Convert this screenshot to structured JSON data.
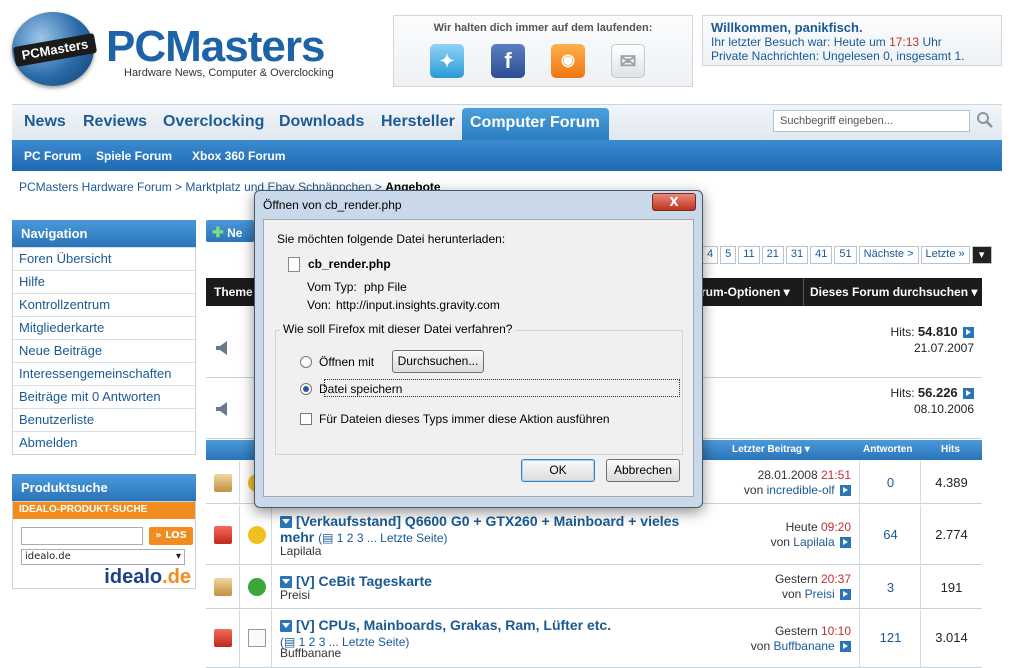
{
  "header": {
    "logo_badge": "PCMasters",
    "brand": "PCMasters",
    "tagline": "Hardware News, Computer & Overclocking",
    "social_title": "Wir halten dich immer auf dem laufenden:",
    "social_icons": [
      "twitter-icon",
      "facebook-icon",
      "rss-icon",
      "newsletter-icon"
    ],
    "welcome": {
      "greeting": "Willkommen, panikfisch.",
      "last_visit_prefix": "Ihr letzter Besuch war: Heute um ",
      "last_visit_time": "17:13",
      "last_visit_suffix": " Uhr",
      "messages": "Private Nachrichten: Ungelesen 0, insgesamt 1."
    }
  },
  "nav": {
    "items": [
      "News",
      "Reviews",
      "Overclocking",
      "Downloads",
      "Hersteller"
    ],
    "active": "Computer Forum",
    "search_placeholder": "Suchbegriff eingeben...",
    "sub_items": [
      "PC Forum",
      "Spiele Forum",
      "Xbox 360 Forum"
    ]
  },
  "breadcrumb": {
    "items": [
      "PCMasters Hardware Forum",
      "Marktplatz und Ebay Schnäppchen"
    ],
    "separator": ">",
    "current": "Angebote"
  },
  "sidebar": {
    "nav_title": "Navigation",
    "nav_items": [
      "Foren Übersicht",
      "Hilfe",
      "Kontrollzentrum",
      "Mitgliederkarte",
      "Neue Beiträge",
      "Interessengemeinschaften",
      "Beiträge mit 0 Antworten",
      "Benutzerliste",
      "Abmelden"
    ],
    "product_title": "Produktsuche",
    "idealo_bar": "IDEALO-PRODUKT-SUCHE",
    "idealo_button": "LOS",
    "idealo_select": "idealo.de",
    "idealo_logo_main": "idealo",
    "idealo_logo_tld": ".de"
  },
  "forum": {
    "new_button": "Ne",
    "pager": [
      "4",
      "5",
      "11",
      "21",
      "31",
      "41",
      "51",
      "Nächste >",
      "Letzte »"
    ],
    "toolbar": {
      "themes": "Theme",
      "forum_options": "rum-Optionen",
      "search_forum": "Dieses Forum durchsuchen"
    },
    "sticky": [
      {
        "hits_label": "Hits:",
        "hits": "54.810",
        "date": "21.07.2007"
      },
      {
        "hits_label": "Hits:",
        "hits": "56.226",
        "date": "08.10.2006"
      }
    ],
    "columns": {
      "last_post": "Letzter Beitrag",
      "answers": "Antworten",
      "hits": "Hits"
    },
    "threads": [
      {
        "title": "",
        "pages": "",
        "author": "",
        "last_date": "28.01.2008",
        "last_time": "21:51",
        "by": "von",
        "last_user": "incredible-olf",
        "answers": "0",
        "hits": "4.389"
      },
      {
        "title": "[Verkaufsstand] Q6600 G0 + GTX260 + Mainboard + vieles mehr",
        "pages": "1 2 3 ... Letzte Seite",
        "author": "Lapilala",
        "last_date": "Heute",
        "last_time": "09:20",
        "by": "von",
        "last_user": "Lapilala",
        "answers": "64",
        "hits": "2.774"
      },
      {
        "title": "[V] CeBit Tageskarte",
        "pages": "",
        "author": "Preisi",
        "last_date": "Gestern",
        "last_time": "20:37",
        "by": "von",
        "last_user": "Preisi",
        "answers": "3",
        "hits": "191"
      },
      {
        "title": "[V] CPUs, Mainboards, Grakas, Ram, Lüfter etc.",
        "pages": "1 2 3 ... Letzte Seite",
        "author": "Buffbanane",
        "last_date": "Gestern",
        "last_time": "10:10",
        "by": "von",
        "last_user": "Buffbanane",
        "answers": "121",
        "hits": "3.014"
      }
    ]
  },
  "dialog": {
    "title": "Öffnen von cb_render.php",
    "close": "X",
    "intro": "Sie möchten folgende Datei herunterladen:",
    "filename": "cb_render.php",
    "type_label": "Vom Typ:",
    "type_value": "php File",
    "from_label": "Von:",
    "from_value": "http://input.insights.gravity.com",
    "question": "Wie soll Firefox mit dieser Datei verfahren?",
    "open_with": "Öffnen mit",
    "browse": "Durchsuchen...",
    "save_file": "Datei speichern",
    "always": "Für Dateien dieses Typs immer diese Aktion ausführen",
    "ok": "OK",
    "cancel": "Abbrechen",
    "selected_option": "save"
  }
}
